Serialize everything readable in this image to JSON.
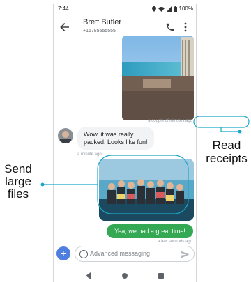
{
  "status": {
    "time": "7:44",
    "battery": "100%"
  },
  "header": {
    "contact_name": "Brett Butler",
    "contact_number": "+16785555555"
  },
  "messages": {
    "ts_beach": "a couple of minutes ago",
    "received_text": "Wow, it was really packed. Looks like fun!",
    "ts_received": "a minute ago",
    "sent_text": "Yea, we had a great time!",
    "ts_sent": "a few seconds ago"
  },
  "compose": {
    "placeholder": "Advanced messaging"
  },
  "callouts": {
    "read_receipts": [
      "Read",
      "receipts"
    ],
    "send_large_files": [
      "Send",
      "large",
      "files"
    ]
  },
  "colors": {
    "accent": "#1aa6c7",
    "bubble_out": "#34a853",
    "fab": "#4e7fe0"
  },
  "icons": [
    "back-arrow-icon",
    "phone-icon",
    "more-vert-icon",
    "add-icon",
    "emoji-icon",
    "send-icon",
    "location-icon",
    "wifi-icon",
    "signal-icon",
    "battery-icon"
  ]
}
